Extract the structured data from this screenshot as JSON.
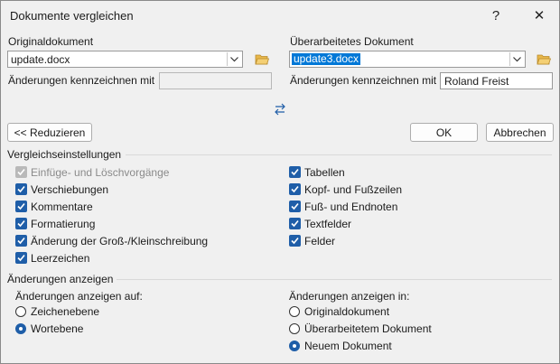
{
  "window": {
    "title": "Dokumente vergleichen",
    "help": "?",
    "close": "✕"
  },
  "original": {
    "label": "Originaldokument",
    "value": "update.docx",
    "mark_label": "Änderungen kennzeichnen mit",
    "mark_value": ""
  },
  "revised": {
    "label": "Überarbeitetes Dokument",
    "value": "update3.docx",
    "mark_label": "Änderungen kennzeichnen mit",
    "mark_value": "Roland Freist"
  },
  "buttons": {
    "reduce": "<< Reduzieren",
    "ok": "OK",
    "cancel": "Abbrechen"
  },
  "comparison": {
    "title": "Vergleichseinstellungen",
    "left": [
      {
        "label": "Einfüge- und Löschvorgänge",
        "checked": true,
        "disabled": true
      },
      {
        "label": "Verschiebungen",
        "checked": true
      },
      {
        "label": "Kommentare",
        "checked": true
      },
      {
        "label": "Formatierung",
        "checked": true
      },
      {
        "label": "Änderung der Groß-/Kleinschreibung",
        "checked": true
      },
      {
        "label": "Leerzeichen",
        "checked": true
      }
    ],
    "right": [
      {
        "label": "Tabellen",
        "checked": true
      },
      {
        "label": "Kopf- und Fußzeilen",
        "checked": true
      },
      {
        "label": "Fuß- und Endnoten",
        "checked": true
      },
      {
        "label": "Textfelder",
        "checked": true
      },
      {
        "label": "Felder",
        "checked": true
      }
    ]
  },
  "show": {
    "title": "Änderungen anzeigen",
    "level_label": "Änderungen anzeigen auf:",
    "levels": [
      {
        "label": "Zeichenebene",
        "selected": false
      },
      {
        "label": "Wortebene",
        "selected": true
      }
    ],
    "target_label": "Änderungen anzeigen in:",
    "targets": [
      {
        "label": "Originaldokument",
        "selected": false
      },
      {
        "label": "Überarbeitetem Dokument",
        "selected": false
      },
      {
        "label": "Neuem Dokument",
        "selected": true
      }
    ]
  },
  "colors": {
    "accent": "#1f5ea8",
    "selection": "#0078d7",
    "folder": "#e8b74a"
  }
}
